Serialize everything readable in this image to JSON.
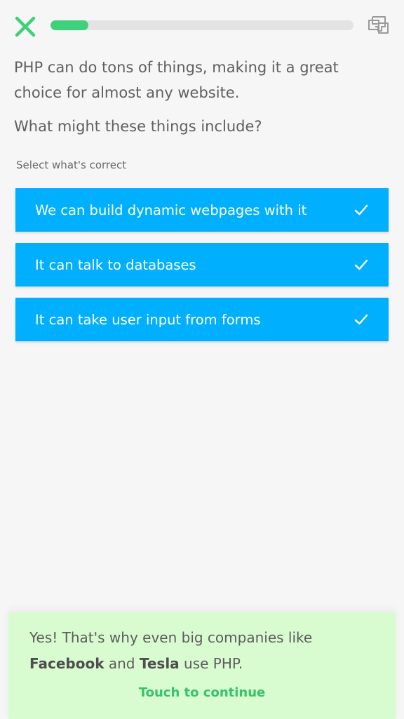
{
  "header": {
    "close_icon": "close-x-icon",
    "report_icon": "report-flag-icon",
    "progress": 0.125,
    "progress_color": "#3fd17a",
    "close_color": "#3fd17a"
  },
  "question": {
    "line1": "PHP can do tons of things, making it a great choice for almost any website.",
    "line2": "What might these things include?"
  },
  "instruction": "Select what's correct",
  "options": [
    {
      "label": "We can build dynamic webpages with it",
      "selected": true,
      "icon": "checkmark-icon"
    },
    {
      "label": "It can talk to databases",
      "selected": true,
      "icon": "checkmark-icon"
    },
    {
      "label": "It can take user input from forms",
      "selected": true,
      "icon": "checkmark-icon"
    }
  ],
  "option_color": "#00b0ff",
  "feedback": {
    "prefix": "Yes! That's why even big companies like",
    "company1": "Facebook",
    "and": "and",
    "company2": "Tesla",
    "suffix": "use PHP.",
    "continue_label": "Touch to continue",
    "background": "#d9fbd0",
    "accent": "#35c467"
  }
}
